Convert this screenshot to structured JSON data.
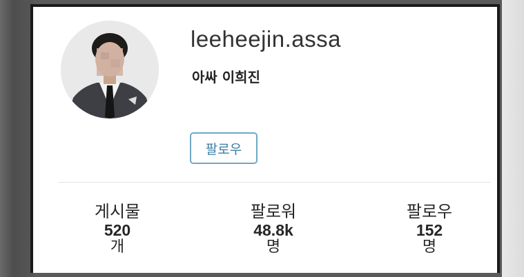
{
  "profile": {
    "username": "leeheejin.assa",
    "full_name": "아싸 이희진",
    "follow_button_label": "팔로우",
    "avatar_icon": "profile-photo"
  },
  "stats": [
    {
      "label": "게시물",
      "value": "520",
      "unit": "개"
    },
    {
      "label": "팔로워",
      "value": "48.8k",
      "unit": "명"
    },
    {
      "label": "팔로우",
      "value": "152",
      "unit": "명"
    }
  ],
  "colors": {
    "follow_border": "#6fa8c4",
    "follow_text": "#3a7ca5",
    "frame": "#1a1a1a"
  }
}
